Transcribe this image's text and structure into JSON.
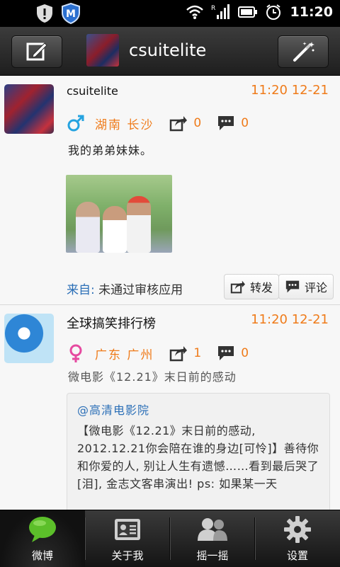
{
  "status_bar": {
    "time": "11:20"
  },
  "header": {
    "username": "csuitelite"
  },
  "posts": [
    {
      "username": "csuitelite",
      "time": "11:20 12-21",
      "location": "湖南 长沙",
      "forward_count": "0",
      "comment_count": "0",
      "text": "我的弟弟妹妹。",
      "source_label": "来自:",
      "source_value": "未通过审核应用",
      "forward_label": "转发",
      "comment_label": "评论"
    },
    {
      "username": "全球搞笑排行榜",
      "time": "11:20 12-21",
      "location": "广东 广州",
      "forward_count": "1",
      "comment_count": "0",
      "text": "微电影《12.21》末日前的感动",
      "quote_author": "@高清电影院",
      "quote_text": "【微电影《12.21》末日前的感动, 2012.12.21你会陪在谁的身边[可怜]】善待你和你爱的人, 别让人生有遗憾……看到最后哭了[泪], 金志文客串演出! ps: 如果某一天"
    }
  ],
  "tabs": [
    {
      "label": "微博"
    },
    {
      "label": "关于我"
    },
    {
      "label": "摇一摇"
    },
    {
      "label": "设置"
    }
  ]
}
